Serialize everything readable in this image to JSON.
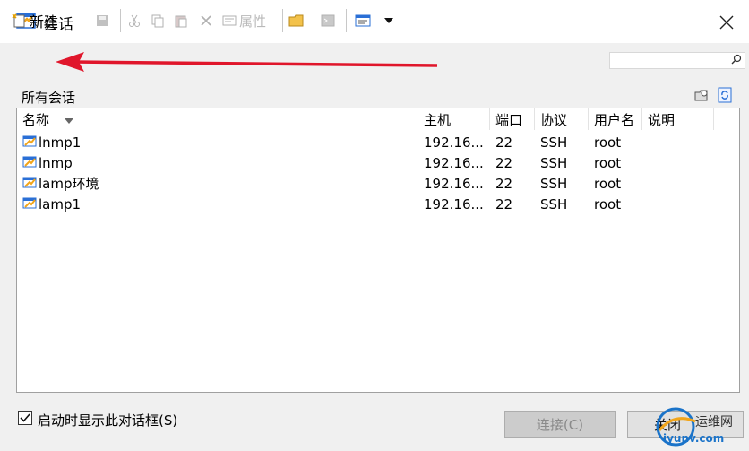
{
  "window": {
    "title": "会话"
  },
  "toolbar": {
    "new_label": "新建",
    "properties_label": "属性"
  },
  "section": {
    "title": "所有会话"
  },
  "table": {
    "columns": [
      "名称",
      "主机",
      "端口",
      "协议",
      "用户名",
      "说明"
    ],
    "rows": [
      {
        "name": "lnmp1",
        "host": "192.16...",
        "port": "22",
        "protocol": "SSH",
        "user": "root",
        "note": ""
      },
      {
        "name": "lnmp",
        "host": "192.16...",
        "port": "22",
        "protocol": "SSH",
        "user": "root",
        "note": ""
      },
      {
        "name": "lamp环境",
        "host": "192.16...",
        "port": "22",
        "protocol": "SSH",
        "user": "root",
        "note": ""
      },
      {
        "name": "lamp1",
        "host": "192.16...",
        "port": "22",
        "protocol": "SSH",
        "user": "root",
        "note": ""
      }
    ]
  },
  "footer": {
    "startup_checkbox_label": "启动时显示此对话框(S)",
    "startup_checked": true,
    "connect_label": "连接(C)",
    "close_label": "关闭"
  },
  "watermark": {
    "line1": "运维网",
    "line2": "iyunv.com"
  },
  "colors": {
    "arrow": "#e0162b",
    "session_icon_blue": "#2a6fd6",
    "session_icon_orange": "#f2a51a"
  }
}
